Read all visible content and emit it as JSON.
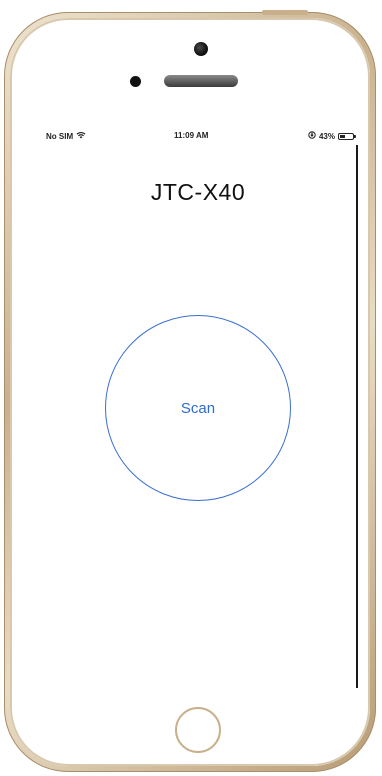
{
  "status_bar": {
    "carrier": "No SIM",
    "wifi_icon": "wifi-icon",
    "time": "11:09 AM",
    "orientation_lock_icon": "rotation-lock-icon",
    "battery_percent": "43%",
    "battery_level": 0.43
  },
  "screen": {
    "title": "JTC-X40",
    "scan_button_label": "Scan"
  },
  "colors": {
    "accent": "#2e6cc9",
    "frame_gold": "#c9b18d"
  }
}
